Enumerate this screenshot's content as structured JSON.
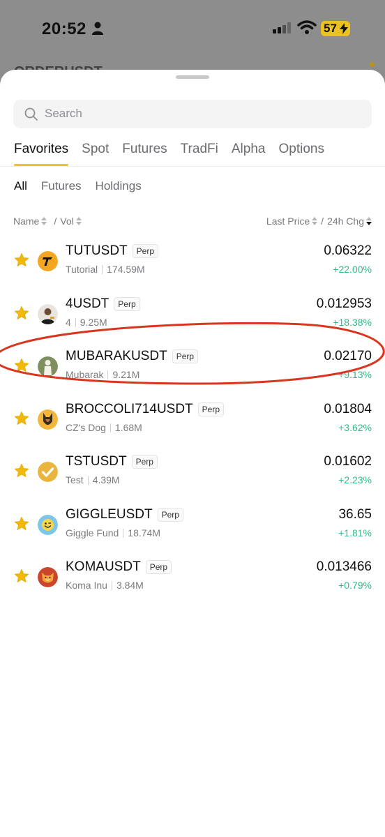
{
  "status_bar": {
    "time": "20:52",
    "battery": "57"
  },
  "background": {
    "title_peek": "ORDERUSDT"
  },
  "search": {
    "placeholder": "Search"
  },
  "tabs": [
    {
      "label": "Favorites",
      "active": true
    },
    {
      "label": "Spot"
    },
    {
      "label": "Futures"
    },
    {
      "label": "TradFi"
    },
    {
      "label": "Alpha"
    },
    {
      "label": "Options"
    }
  ],
  "subtabs": [
    {
      "label": "All",
      "active": true
    },
    {
      "label": "Futures"
    },
    {
      "label": "Holdings"
    }
  ],
  "columns": {
    "name": "Name",
    "vol": "Vol",
    "last_price": "Last Price",
    "change": "24h Chg"
  },
  "rows": [
    {
      "symbol": "TUTUSDT",
      "badge": "Perp",
      "name": "Tutorial",
      "volume": "174.59M",
      "price": "0.06322",
      "change": "+22.00%"
    },
    {
      "symbol": "4USDT",
      "badge": "Perp",
      "name": "4",
      "volume": "9.25M",
      "price": "0.012953",
      "change": "+18.38%"
    },
    {
      "symbol": "MUBARAKUSDT",
      "badge": "Perp",
      "name": "Mubarak",
      "volume": "9.21M",
      "price": "0.02170",
      "change": "+9.13%"
    },
    {
      "symbol": "BROCCOLI714USDT",
      "badge": "Perp",
      "name": "CZ's Dog",
      "volume": "1.68M",
      "price": "0.01804",
      "change": "+3.62%"
    },
    {
      "symbol": "TSTUSDT",
      "badge": "Perp",
      "name": "Test",
      "volume": "4.39M",
      "price": "0.01602",
      "change": "+2.23%"
    },
    {
      "symbol": "GIGGLEUSDT",
      "badge": "Perp",
      "name": "Giggle Fund",
      "volume": "18.74M",
      "price": "36.65",
      "change": "+1.81%"
    },
    {
      "symbol": "KOMAUSDT",
      "badge": "Perp",
      "name": "Koma Inu",
      "volume": "3.84M",
      "price": "0.013466",
      "change": "+0.79%"
    }
  ],
  "colors": {
    "accent": "#efc420",
    "positive": "#2ebd85",
    "star": "#f0b90b",
    "annotation": "#d8361f"
  }
}
